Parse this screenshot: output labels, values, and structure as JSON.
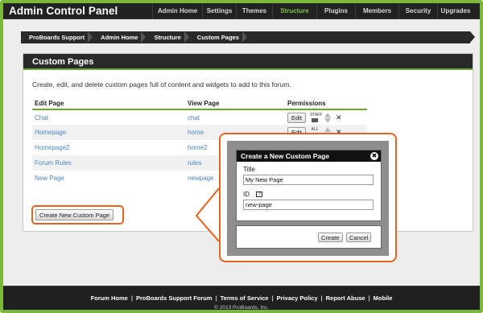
{
  "app": {
    "title": "Admin Control Panel"
  },
  "nav": [
    {
      "label": "Admin Home",
      "width": 62
    },
    {
      "label": "Settings",
      "width": 42
    },
    {
      "label": "Themes",
      "width": 45
    },
    {
      "label": "Structure",
      "width": 55,
      "active": true
    },
    {
      "label": "Plugins",
      "width": 48
    },
    {
      "label": "Members",
      "width": 54
    },
    {
      "label": "Security",
      "width": 48
    },
    {
      "label": "Upgrades",
      "width": 45
    }
  ],
  "breadcrumb": [
    "ProBoards Support",
    "Admin Home",
    "Structure",
    "Custom Pages"
  ],
  "panel": {
    "title": "Custom Pages",
    "description": "Create, edit, and delete custom pages full of content and widgets to add to this forum.",
    "columns": {
      "edit": "Edit Page",
      "view": "View Page",
      "permissions": "Permissions"
    },
    "rows": [
      {
        "edit": "Chat",
        "view": "chat"
      },
      {
        "edit": "Homepage",
        "view": "home"
      },
      {
        "edit": "Homepage2",
        "view": "home2"
      },
      {
        "edit": "Forum Rules",
        "view": "rules"
      },
      {
        "edit": "New Page",
        "view": "newpage"
      }
    ],
    "edit_label": "Edit",
    "staff_label": "STAFF",
    "all_label": "ALL",
    "delete_glyph": "✕",
    "create_button": "Create New Custom Page"
  },
  "modal": {
    "title": "Create a New Custom Page",
    "close_glyph": "✖",
    "title_label": "Title",
    "title_value": "My New Page",
    "id_label": "ID",
    "help_glyph": "?",
    "id_value": "new-page",
    "create_label": "Create",
    "cancel_label": "Cancel"
  },
  "footer": {
    "links": [
      "Forum Home",
      "ProBoards Support Forum",
      "Terms of Service",
      "Privacy Policy",
      "Report Abuse",
      "Mobile"
    ],
    "separator": "|",
    "copyright": "© 2013 ProBoards, Inc."
  },
  "colors": {
    "accent": "#7ab83a",
    "highlight": "#e8641e",
    "link": "#4a87c7",
    "bar": "#222222"
  }
}
